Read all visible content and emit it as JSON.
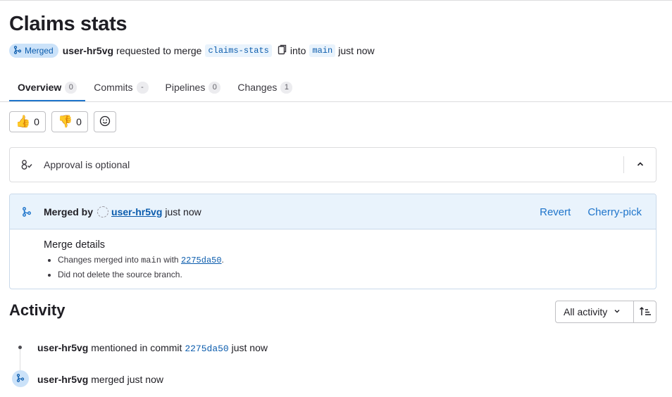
{
  "page": {
    "title": "Claims stats",
    "status_badge": "Merged",
    "author": "user-hr5vg",
    "requested_text": "requested to merge",
    "source_branch": "claims-stats",
    "into_text": "into",
    "target_branch": "main",
    "time": "just now"
  },
  "tabs": [
    {
      "label": "Overview",
      "count": "0"
    },
    {
      "label": "Commits",
      "count": "-"
    },
    {
      "label": "Pipelines",
      "count": "0"
    },
    {
      "label": "Changes",
      "count": "1"
    }
  ],
  "reactions": {
    "thumbs_up": {
      "emoji": "👍",
      "count": "0"
    },
    "thumbs_down": {
      "emoji": "👎",
      "count": "0"
    }
  },
  "approval": {
    "text": "Approval is optional"
  },
  "merge_widget": {
    "merged_by_label": "Merged by",
    "user": "user-hr5vg",
    "time": "just now",
    "revert": "Revert",
    "cherry_pick": "Cherry-pick",
    "details_title": "Merge details",
    "details": {
      "line1_pre": "Changes merged into",
      "line1_branch": "main",
      "line1_with": "with",
      "line1_sha": "2275da50",
      "line1_end": ".",
      "line2": "Did not delete the source branch."
    }
  },
  "activity": {
    "heading": "Activity",
    "filter_label": "All activity",
    "notes": [
      {
        "user": "user-hr5vg",
        "text": "mentioned in commit",
        "sha": "2275da50",
        "time": "just now"
      },
      {
        "user": "user-hr5vg",
        "text": "merged",
        "time": "just now"
      }
    ]
  },
  "colors": {
    "accent": "#1f75cb",
    "badge_bg": "#cbe2f9",
    "widget_bg": "#e9f3fc"
  },
  "icons": [
    "merge-icon",
    "copy-icon",
    "approval-icon",
    "chevron-up-icon",
    "chevron-down-icon",
    "smiley-icon",
    "sort-icon"
  ]
}
